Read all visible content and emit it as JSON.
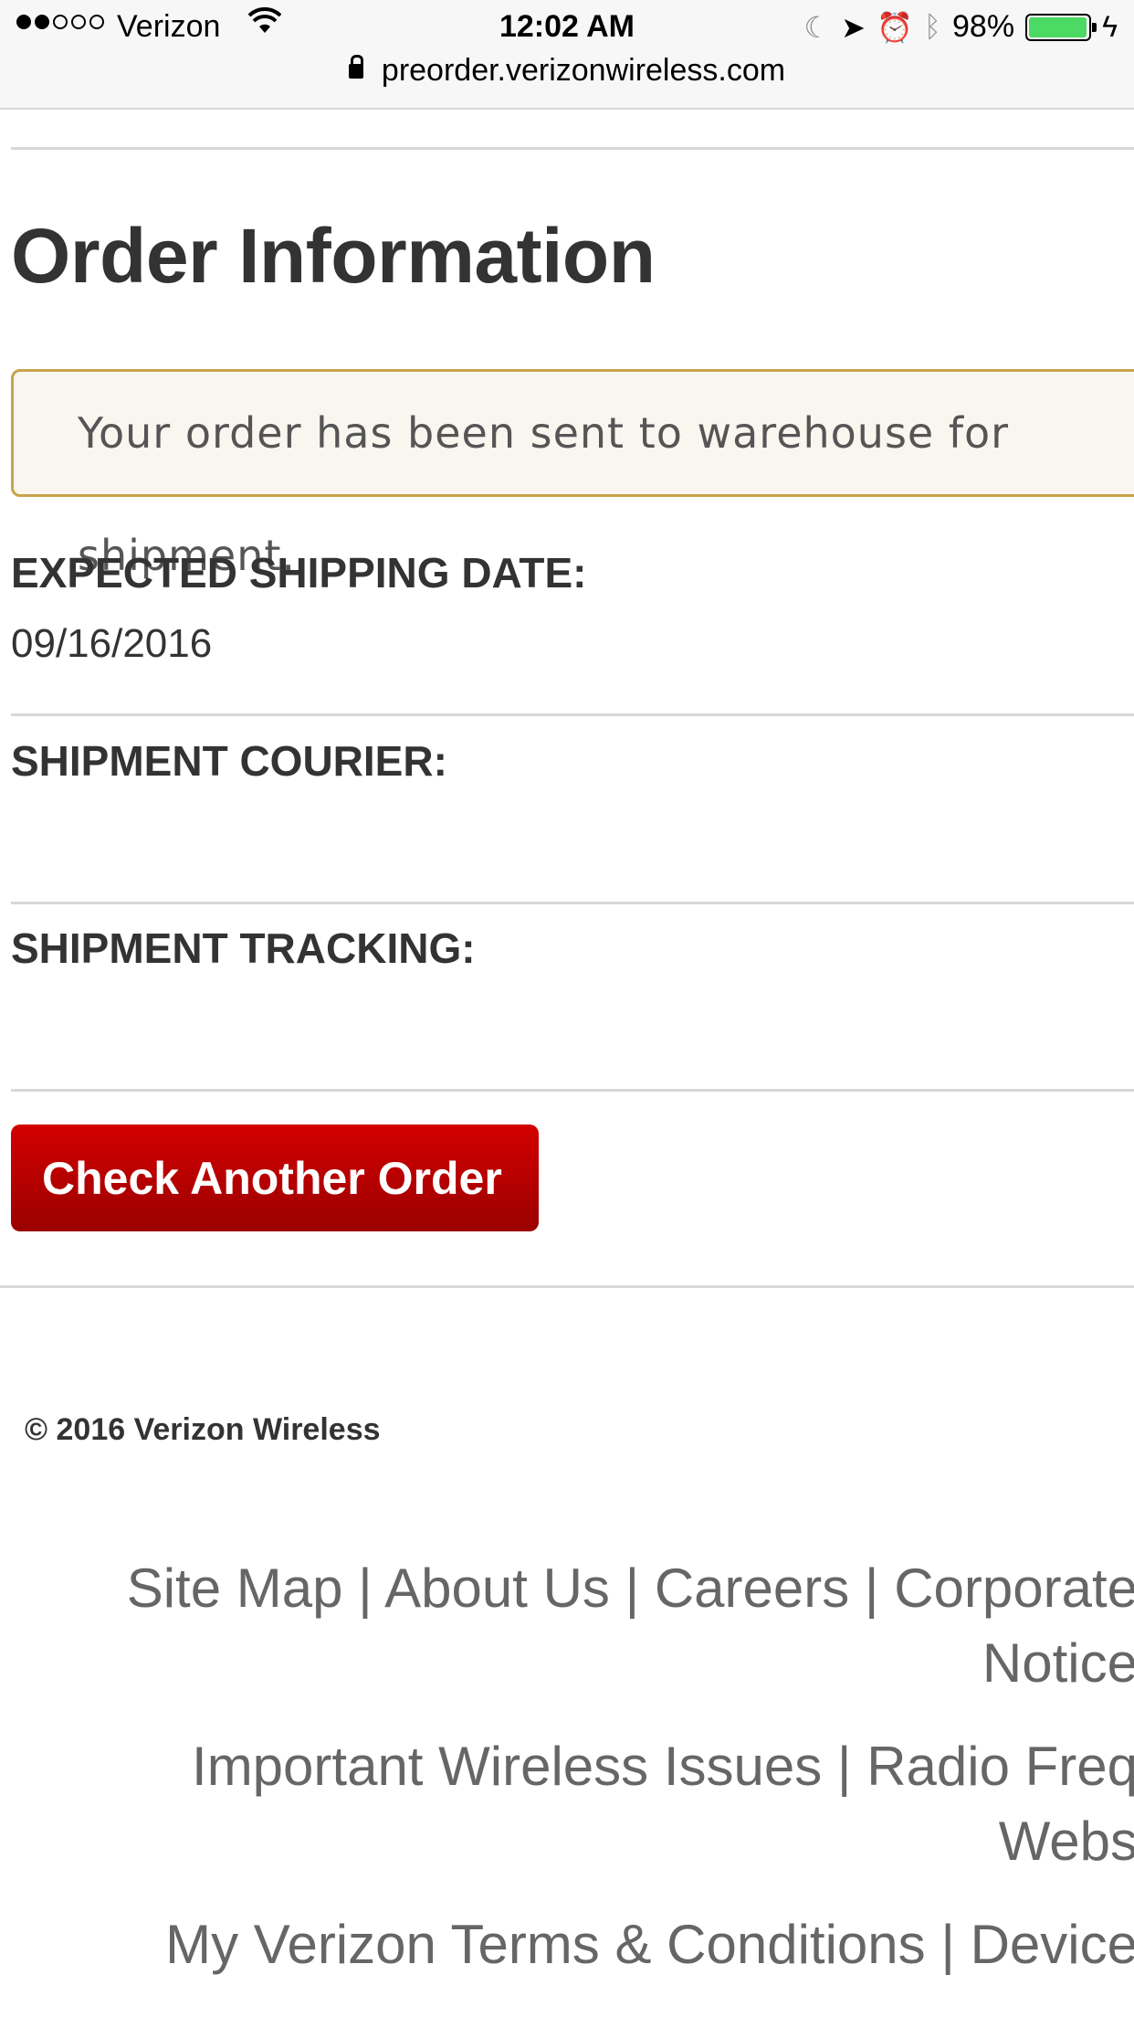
{
  "status_bar": {
    "carrier": "Verizon",
    "time": "12:02 AM",
    "battery_percent": "98%",
    "battery_level": 0.98,
    "signal_bars_filled": 2,
    "signal_bars_total": 5,
    "icons": [
      "wifi-icon",
      "moon-icon",
      "location-arrow-icon",
      "alarm-icon",
      "bluetooth-icon",
      "battery-icon",
      "charging-icon"
    ]
  },
  "url_bar": {
    "url": "preorder.verizonwireless.com"
  },
  "main": {
    "title": "Order Information",
    "notice": "Your order has been sent to warehouse for shipment.",
    "shipping_date_label": "EXPECTED SHIPPING DATE:",
    "shipping_date_value": "09/16/2016",
    "courier_label": "SHIPMENT COURIER:",
    "courier_value": "",
    "tracking_label": "SHIPMENT TRACKING:",
    "tracking_value": "",
    "button_label": "Check Another Order"
  },
  "footer": {
    "copyright": "© 2016 Verizon Wireless",
    "separator": "|",
    "links": {
      "site_map": "Site Map",
      "about_us": "About Us",
      "careers": "Careers",
      "corporate": "Corporate",
      "notice": "Notice",
      "important_wireless": "Important Wireless Issues",
      "radio_freq": "Radio Freq",
      "webs": "Webs",
      "terms": "My Verizon Terms & Conditions",
      "device": "Device"
    }
  },
  "colors": {
    "button_top": "#d30000",
    "button_bottom": "#9a0000",
    "notice_border": "#c9a24a",
    "notice_bg": "#f9f6f0",
    "battery": "#4cd964"
  }
}
